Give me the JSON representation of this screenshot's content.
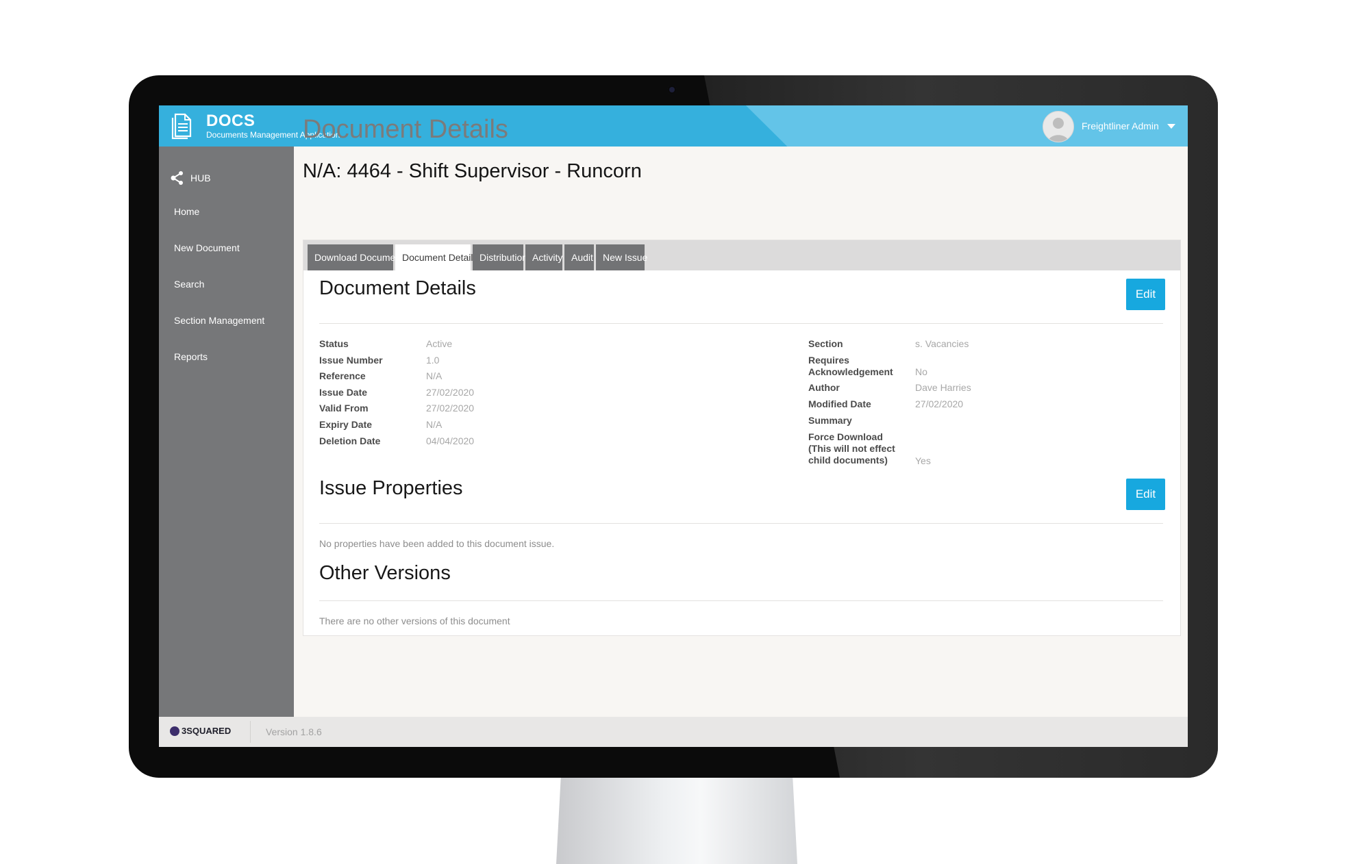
{
  "header": {
    "app_name": "DOCS",
    "app_subtitle": "Documents Management Application",
    "user_name": "Freightliner Admin"
  },
  "sidebar": {
    "hub_label": "HUB",
    "items": [
      {
        "label": "Home"
      },
      {
        "label": "New Document"
      },
      {
        "label": "Search"
      },
      {
        "label": "Section Management"
      },
      {
        "label": "Reports"
      }
    ]
  },
  "main": {
    "page_title": "Document Details",
    "document_title": "N/A: 4464 - Shift Supervisor - Runcorn",
    "tabs": [
      {
        "label": "Download Document",
        "active": false
      },
      {
        "label": "Document Details",
        "active": true
      },
      {
        "label": "Distribution",
        "active": false
      },
      {
        "label": "Activity",
        "active": false
      },
      {
        "label": "Audit",
        "active": false
      },
      {
        "label": "New Issue",
        "active": false
      }
    ],
    "details": {
      "title": "Document Details",
      "edit_label": "Edit",
      "left_fields": [
        {
          "label": "Status",
          "value": "Active"
        },
        {
          "label": "Issue Number",
          "value": "1.0"
        },
        {
          "label": "Reference",
          "value": "N/A"
        },
        {
          "label": "Issue Date",
          "value": "27/02/2020"
        },
        {
          "label": "Valid From",
          "value": "27/02/2020"
        },
        {
          "label": "Expiry Date",
          "value": "N/A"
        },
        {
          "label": "Deletion Date",
          "value": "04/04/2020"
        }
      ],
      "right_fields": [
        {
          "label": "Section",
          "value": "s. Vacancies"
        },
        {
          "label": "Requires Acknowledgement",
          "value": "No"
        },
        {
          "label": "Author",
          "value": "Dave Harries"
        },
        {
          "label": "Modified Date",
          "value": "27/02/2020"
        },
        {
          "label": "Summary",
          "value": ""
        },
        {
          "label": "Force Download (This will not effect child documents)",
          "value": "Yes"
        }
      ]
    },
    "issue_properties": {
      "title": "Issue Properties",
      "edit_label": "Edit",
      "empty_text": "No properties have been added to this document issue."
    },
    "other_versions": {
      "title": "Other Versions",
      "empty_text": "There are no other versions of this document"
    }
  },
  "footer": {
    "brand": "3SQUARED",
    "version": "Version 1.8.6"
  },
  "colors": {
    "header_blue": "#35b0dd",
    "sidebar_gray": "#767779",
    "button_blue": "#17a8df",
    "tab_gray": "#727375"
  }
}
